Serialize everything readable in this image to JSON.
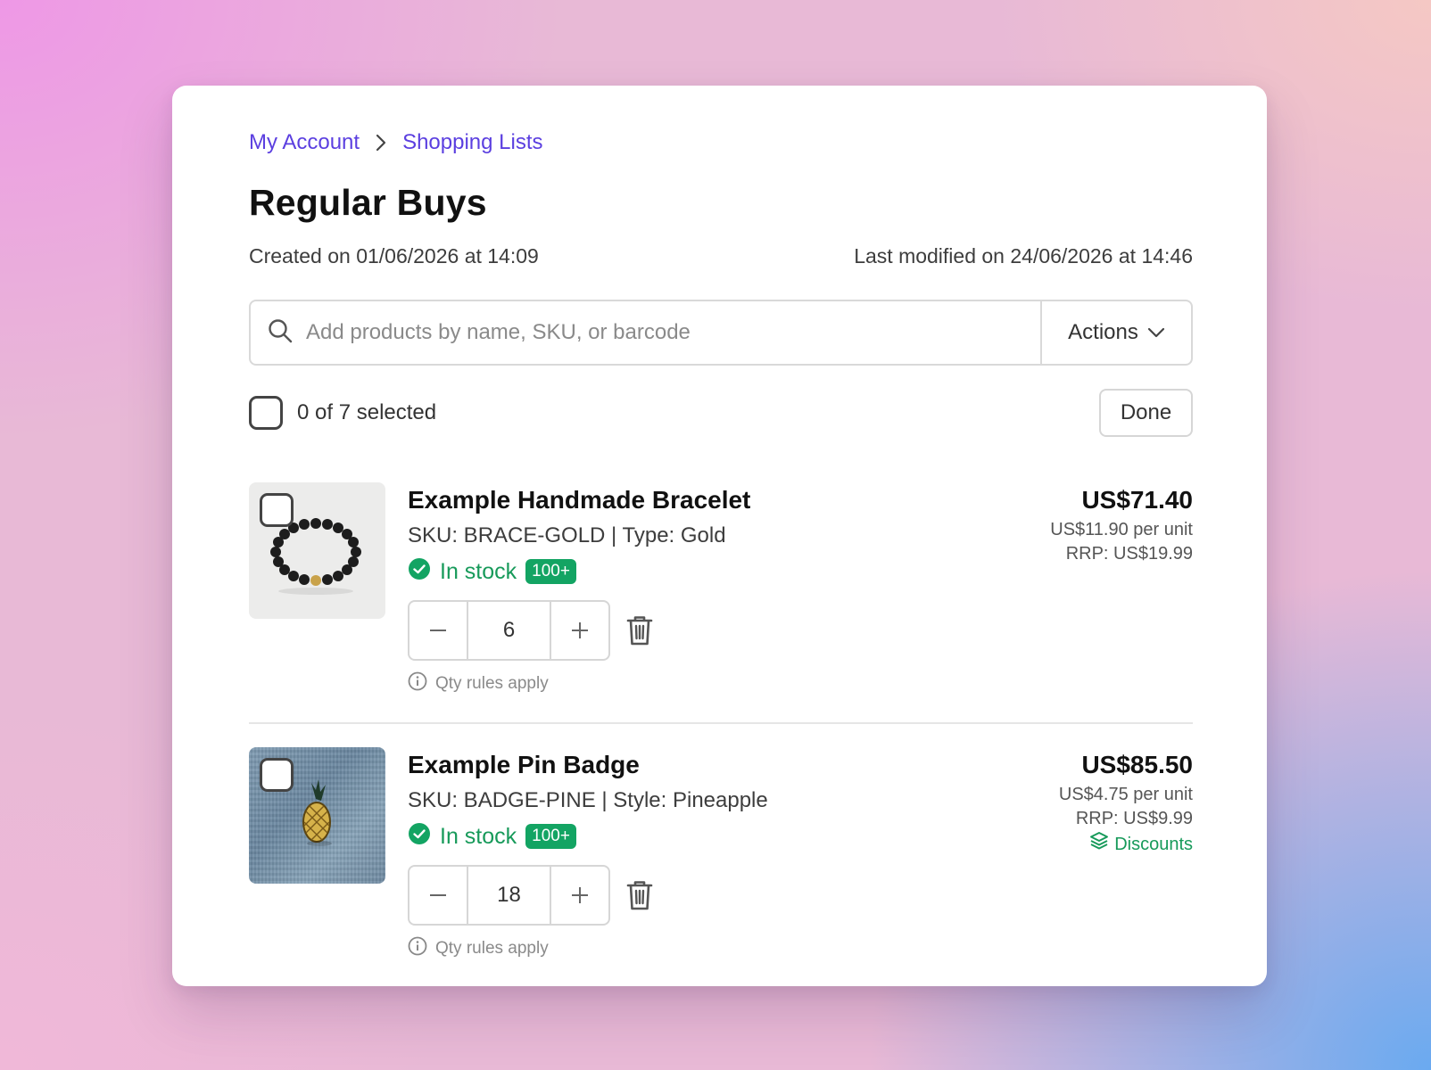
{
  "breadcrumb": {
    "items": [
      "My Account",
      "Shopping Lists"
    ]
  },
  "page": {
    "title": "Regular Buys",
    "created": "Created on 01/06/2026 at 14:09",
    "modified": "Last modified on 24/06/2026 at 14:46"
  },
  "search": {
    "placeholder": "Add products by name, SKU, or barcode",
    "value": ""
  },
  "actions": {
    "label": "Actions"
  },
  "selection": {
    "label": "0 of 7 selected",
    "done_label": "Done"
  },
  "products": [
    {
      "name": "Example Handmade Bracelet",
      "sku": "SKU: BRACE-GOLD | Type: Gold",
      "stock": "In stock",
      "stock_badge": "100+",
      "qty": "6",
      "qty_note": "Qty rules apply",
      "total": "US$71.40",
      "unit": "US$11.90 per unit",
      "rrp": "RRP: US$19.99"
    },
    {
      "name": "Example Pin Badge",
      "sku": "SKU: BADGE-PINE | Style: Pineapple",
      "stock": "In stock",
      "stock_badge": "100+",
      "qty": "18",
      "qty_note": "Qty rules apply",
      "total": "US$85.50",
      "unit": "US$4.75 per unit",
      "rrp": "RRP: US$9.99",
      "discounts": "Discounts"
    }
  ],
  "colors": {
    "link": "#5b3fe0",
    "stock_green": "#179a5a",
    "badge_green": "#13a463"
  },
  "icons": [
    "chevron-right-icon",
    "search-icon",
    "chevron-down-icon",
    "check-circle-icon",
    "minus-icon",
    "plus-icon",
    "trash-icon",
    "info-icon",
    "stack-icon"
  ]
}
